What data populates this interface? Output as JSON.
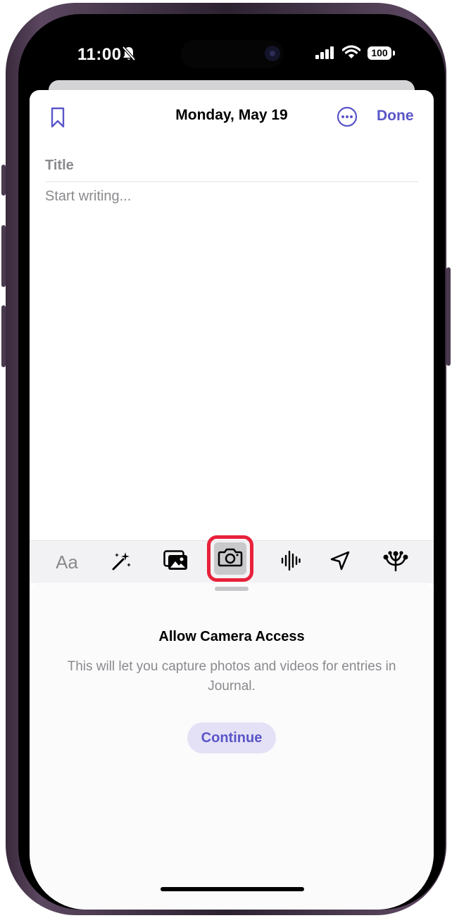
{
  "status": {
    "time": "11:00",
    "battery": "100"
  },
  "header": {
    "date": "Monday, May 19",
    "done_label": "Done"
  },
  "editor": {
    "title_placeholder": "Title",
    "body_placeholder": "Start writing..."
  },
  "toolbar": {
    "text_format_label": "Aa",
    "items": [
      "text-format-icon",
      "magic-wand-icon",
      "photo-library-icon",
      "camera-icon",
      "waveform-icon",
      "location-arrow-icon",
      "suggestions-icon"
    ]
  },
  "permission": {
    "title": "Allow Camera Access",
    "description": "This will let you capture photos and videos for entries in Journal.",
    "continue_label": "Continue"
  },
  "colors": {
    "accent": "#5a55c8",
    "highlight": "#e8213a"
  }
}
